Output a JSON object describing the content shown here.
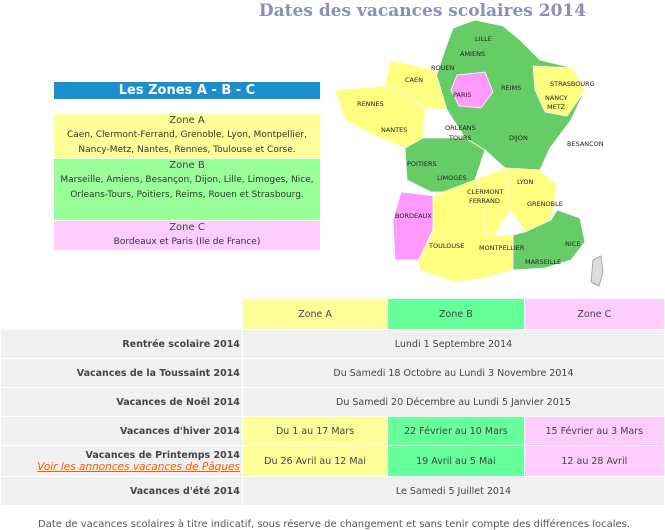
{
  "page": {
    "title": "Dates des vacances scolaires 2014"
  },
  "zones": {
    "header": "Les Zones A - B - C",
    "a": {
      "name": "Zone A",
      "cities": "Caen, Clermont-Ferrand, Grenoble, Lyon, Montpellier, Nancy-Metz, Nantes, Rennes, Toulouse et Corse."
    },
    "b": {
      "name": "Zone B",
      "cities": "Marseille, Amiens, Besançon, Dijon, Lille, Limoges, Nice, Orleans-Tours, Poitiers, Reims, Rouen et Strasbourg."
    },
    "c": {
      "name": "Zone C",
      "cities": "Bordeaux et Paris (Ile de France)"
    }
  },
  "map": {
    "colors": {
      "zone_a": "#ffff80",
      "zone_b": "#66cc66",
      "zone_c": "#ff99ff",
      "other": "#dddddd"
    },
    "labels": [
      "LILLE",
      "AMIENS",
      "ROUEN",
      "CAEN",
      "PARIS",
      "REIMS",
      "STRASBOURG",
      "NANCY",
      "METZ",
      "RENNES",
      "NANTES",
      "ORLEANS",
      "TOURS",
      "DIJON",
      "BESANCON",
      "POITIERS",
      "LIMOGES",
      "CLERMONT",
      "FERRAND",
      "LYON",
      "GRENOBLE",
      "BORDEAUX",
      "TOULOUSE",
      "MONTPELLIER",
      "NICE",
      "MARSEILLE"
    ]
  },
  "table": {
    "headers": {
      "a": "Zone A",
      "b": "Zone B",
      "c": "Zone C"
    },
    "rows": [
      {
        "label": "Rentrée scolaire 2014",
        "all": "Lundi 1 Septembre 2014"
      },
      {
        "label": "Vacances de la Toussaint 2014",
        "all": "Du Samedi 18 Octobre au Lundi 3 Novembre 2014"
      },
      {
        "label": "Vacances de Noël 2014",
        "all": "Du Samedi 20 Décembre au Lundi 5 Janvier 2015"
      },
      {
        "label": "Vacances d'hiver 2014",
        "a": "Du 1 au 17 Mars",
        "b": "22 Février au 10 Mars",
        "c": "15 Février au 3 Mars"
      },
      {
        "label": "Vacances de Printemps 2014",
        "link": "Voir les annonces vacances de Pâques",
        "a": "Du 26 Avril au 12 Mai",
        "b": "19 Avril au 5 Mai",
        "c": "12 au 28 Avril"
      },
      {
        "label": "Vacances d'été 2014",
        "all": "Le Samedi 5 Juillet 2014"
      }
    ]
  },
  "footnote": "Date de vacances scolaires à titre indicatif, sous réserve de changement et sans tenir compte des différences locales."
}
